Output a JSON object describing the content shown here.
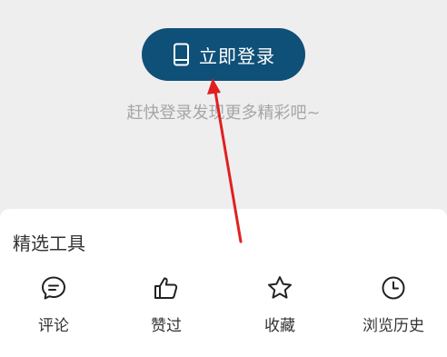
{
  "login": {
    "button_label": "立即登录",
    "button_icon": "phone-icon",
    "hint": "赶快登录发现更多精彩吧~",
    "accent_color": "#0f5078"
  },
  "tools": {
    "title": "精选工具",
    "items": [
      {
        "label": "评论",
        "icon": "comment-icon"
      },
      {
        "label": "赞过",
        "icon": "thumbs-up-icon"
      },
      {
        "label": "收藏",
        "icon": "star-icon"
      },
      {
        "label": "浏览历史",
        "icon": "clock-icon"
      }
    ]
  },
  "annotation": {
    "arrow_color": "#e02020"
  }
}
